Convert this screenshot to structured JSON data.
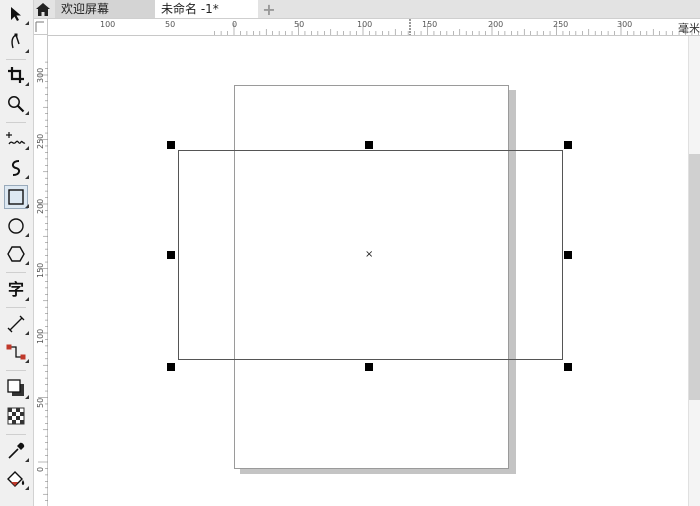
{
  "tabs": [
    {
      "label": "欢迎屏幕"
    },
    {
      "label": "未命名 -1*"
    }
  ],
  "ruler": {
    "unit": "毫米",
    "top_labels": [
      "100",
      "50",
      "0",
      "50",
      "100",
      "150",
      "200",
      "250",
      "300"
    ],
    "left_labels": [
      "300",
      "250",
      "200",
      "150",
      "100",
      "50",
      "0"
    ]
  },
  "tools": [
    {
      "name": "pick-tool",
      "icon": "arrow-cursor-icon"
    },
    {
      "name": "shape-tool",
      "icon": "node-edit-icon"
    },
    {
      "name": "crop-tool",
      "icon": "crop-icon"
    },
    {
      "name": "zoom-tool",
      "icon": "magnifier-icon"
    },
    {
      "name": "freehand-tool",
      "icon": "freehand-icon"
    },
    {
      "name": "artistic-media-tool",
      "icon": "artistic-curve-icon"
    },
    {
      "name": "rectangle-tool",
      "icon": "rectangle-icon"
    },
    {
      "name": "ellipse-tool",
      "icon": "ellipse-icon"
    },
    {
      "name": "polygon-tool",
      "icon": "hexagon-icon"
    },
    {
      "name": "text-tool",
      "icon": "text-icon",
      "label": "字"
    },
    {
      "name": "parallel-dimension-tool",
      "icon": "dimension-line-icon"
    },
    {
      "name": "connector-tool",
      "icon": "connector-icon"
    },
    {
      "name": "drop-shadow-tool",
      "icon": "drop-shadow-icon"
    },
    {
      "name": "transparency-tool",
      "icon": "checkerboard-icon"
    },
    {
      "name": "eyedropper-tool",
      "icon": "eyedropper-icon"
    },
    {
      "name": "interactive-fill-tool",
      "icon": "paint-bucket-icon"
    }
  ],
  "colors": {
    "accent": "#1e90ff",
    "handle": "#000000",
    "connector_red": "#c0392b"
  }
}
